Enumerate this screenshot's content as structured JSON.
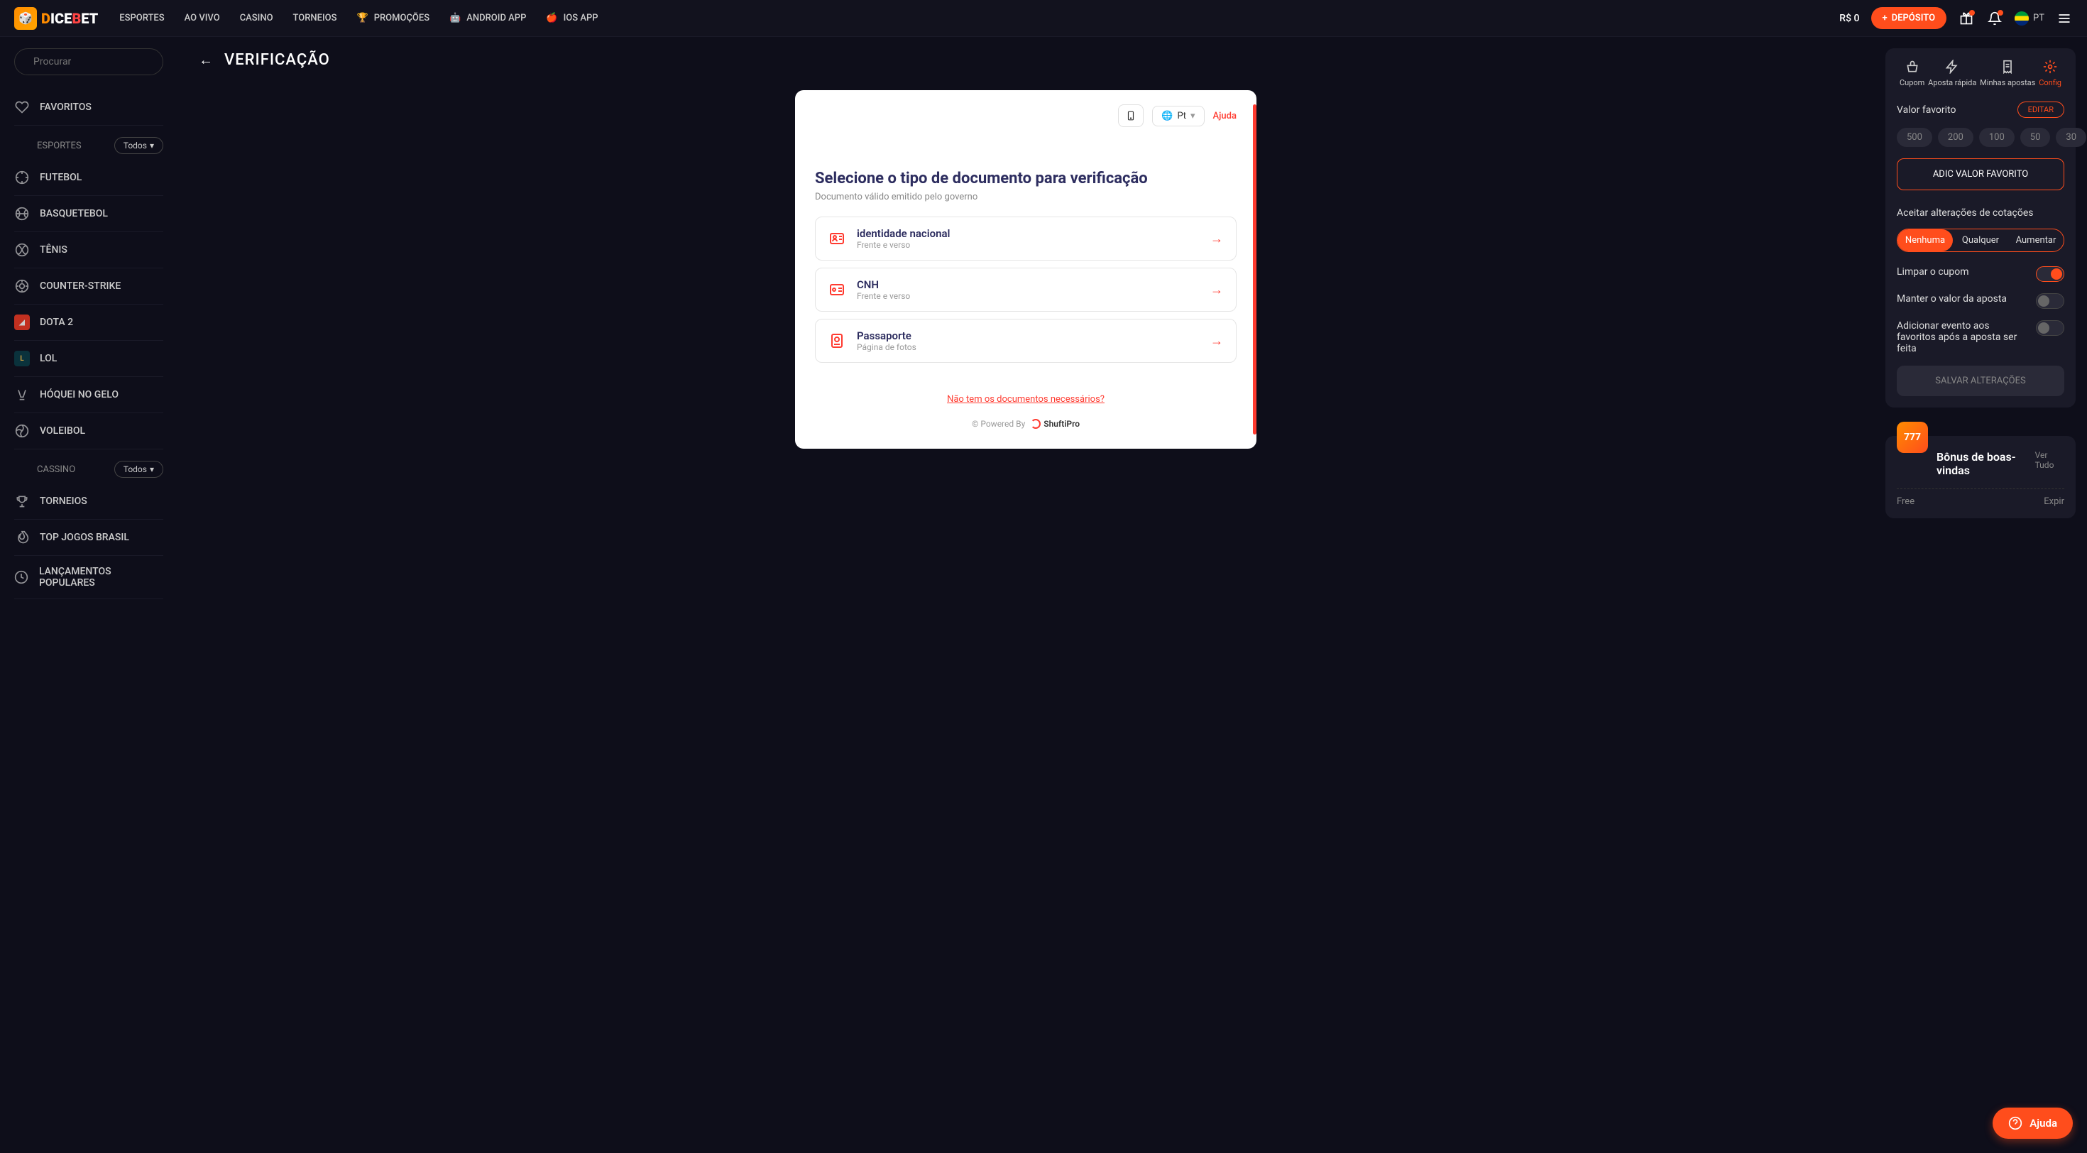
{
  "header": {
    "logo_text": "DICEBET",
    "nav": [
      "ESPORTES",
      "AO VIVO",
      "CASINO",
      "TORNEIOS",
      "PROMOÇÕES",
      "ANDROID APP",
      "IOS APP"
    ],
    "balance": "R$ 0",
    "deposit": "DEPÓSITO",
    "lang": "PT"
  },
  "sidebar": {
    "search_placeholder": "Procurar",
    "favorites": "FAVORITOS",
    "sports_label": "ESPORTES",
    "sports_tag": "Todos",
    "sports": [
      "FUTEBOL",
      "BASQUETEBOL",
      "TÊNIS",
      "COUNTER-STRIKE",
      "DOTA 2",
      "LOL",
      "HÓQUEI NO GELO",
      "VOLEIBOL"
    ],
    "casino_label": "CASSINO",
    "casino_tag": "Todos",
    "casino": [
      "TORNEIOS",
      "TOP JOGOS BRASIL",
      "LANÇAMENTOS POPULARES"
    ]
  },
  "main": {
    "title": "VERIFICAÇÃO",
    "lang_label": "Pt",
    "help": "Ajuda",
    "verify_title": "Selecione o tipo de documento para verificação",
    "verify_subtitle": "Documento válido emitido pelo governo",
    "docs": [
      {
        "title": "identidade nacional",
        "sub": "Frente e verso"
      },
      {
        "title": "CNH",
        "sub": "Frente e verso"
      },
      {
        "title": "Passaporte",
        "sub": "Página de fotos"
      }
    ],
    "no_docs": "Não tem os documentos necessários?",
    "powered": "© Powered By",
    "shufti": "ShuftiPro"
  },
  "panel": {
    "tabs": [
      "Cupom",
      "Aposta rápida",
      "Minhas apostas",
      "Config"
    ],
    "fav_label": "Valor favorito",
    "edit": "EDITAR",
    "amounts": [
      "500",
      "200",
      "100",
      "50",
      "30"
    ],
    "add_fav": "ADIC VALOR FAVORITO",
    "odds_label": "Aceitar alterações de cotações",
    "odds_options": [
      "Nenhuma",
      "Qualquer",
      "Aumentar"
    ],
    "toggles": [
      "Limpar o cupom",
      "Manter o valor da aposta",
      "Adicionar evento aos favoritos após a aposta ser feita"
    ],
    "save": "SALVAR ALTERAÇÕES"
  },
  "bonus": {
    "title": "Bônus de boas-vindas",
    "view_all": "Ver Tudo",
    "free": "Free",
    "expire": "Expir"
  },
  "fab": "Ajuda"
}
